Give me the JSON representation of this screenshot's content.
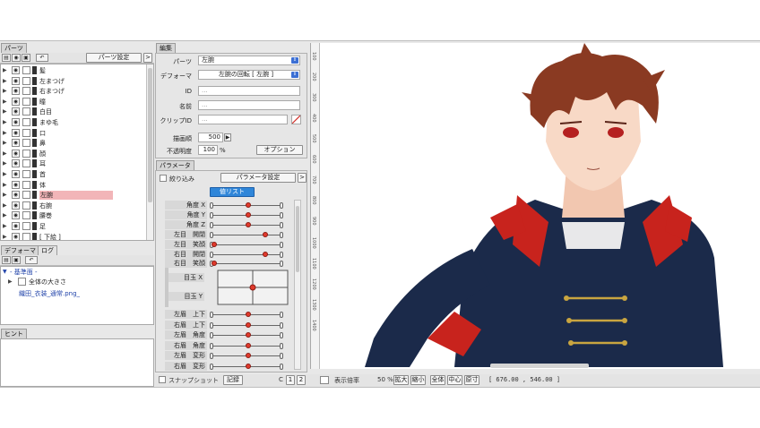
{
  "parts_panel": {
    "tab": "パーツ",
    "settings_button": "パーツ設定",
    "expand_button": ">",
    "items": [
      {
        "label": "髪",
        "selected": false
      },
      {
        "label": "左まつげ",
        "selected": false
      },
      {
        "label": "右まつげ",
        "selected": false
      },
      {
        "label": "瞳",
        "selected": false
      },
      {
        "label": "白目",
        "selected": false
      },
      {
        "label": "まゆ毛",
        "selected": false
      },
      {
        "label": "口",
        "selected": false
      },
      {
        "label": "鼻",
        "selected": false
      },
      {
        "label": "顔",
        "selected": false
      },
      {
        "label": "耳",
        "selected": false
      },
      {
        "label": "首",
        "selected": false
      },
      {
        "label": "体",
        "selected": false
      },
      {
        "label": "左腕",
        "selected": true
      },
      {
        "label": "右腕",
        "selected": false
      },
      {
        "label": "腰巻",
        "selected": false
      },
      {
        "label": "足",
        "selected": false
      },
      {
        "label": "[ 下絵 ]",
        "selected": false
      }
    ]
  },
  "deformer_panel": {
    "tab_deformer": "デフォーマ",
    "tab_log": "ログ",
    "tree_root": "- 基準面 -",
    "tree_child": "全体の大きさ",
    "tree_file": "織田_衣装_通常.png_"
  },
  "hint_panel": {
    "tab": "ヒント"
  },
  "edit_panel": {
    "tab": "編集",
    "parts_label": "パーツ",
    "parts_value": "左腕",
    "deformer_label": "デフォーマ",
    "deformer_value": "左腕の回転 [ 左腕 ]",
    "id_label": "ID",
    "id_value": "...",
    "name_label": "名前",
    "name_value": "...",
    "clip_label": "クリップID",
    "clip_value": "...",
    "draw_order_label": "描画順",
    "draw_order_value": "500",
    "opacity_label": "不透明度",
    "opacity_value": "100",
    "opacity_unit": "%",
    "option_button": "オプション"
  },
  "param_panel": {
    "tab": "パラメータ",
    "filter_label": "絞り込み",
    "settings_button": "パラメータ設定",
    "expand_button": ">",
    "list_button": "値リスト",
    "eye_x_label": "目玉 X",
    "eye_y_label": "目玉 Y",
    "params": [
      {
        "label": "角度 X",
        "value": 0.5
      },
      {
        "label": "角度 Y",
        "value": 0.5
      },
      {
        "label": "角度 Z",
        "value": 0.5
      },
      {
        "label": "左目　開閉",
        "value": 0.75
      },
      {
        "label": "左目　笑顔",
        "value": 0.0
      },
      {
        "label": "右目　開閉",
        "value": 0.75
      },
      {
        "label": "右目　笑顔",
        "value": 0.0
      },
      {
        "label": "左眉　上下",
        "value": 0.5
      },
      {
        "label": "右眉　上下",
        "value": 0.5
      },
      {
        "label": "左眉　角度",
        "value": 0.5
      },
      {
        "label": "右眉　角度",
        "value": 0.5
      },
      {
        "label": "左眉　変形",
        "value": 0.5
      },
      {
        "label": "右眉　変形",
        "value": 0.5
      }
    ]
  },
  "bottom_bar": {
    "snapshot_label": "スナップショット",
    "record_button": "記録",
    "c_label": "C",
    "page1": "1",
    "page2": "2",
    "zoom_label": "表示倍率",
    "zoom_value": "50 %",
    "zoom_in": "拡大",
    "zoom_out": "縮小",
    "fit_all": "全体",
    "center": "中心",
    "actual_size": "原寸",
    "coords": "[   676.00 ,   546.00 ]"
  },
  "ruler": {
    "labels": [
      "100",
      "200",
      "300",
      "400",
      "500",
      "600",
      "700",
      "800",
      "900",
      "1000",
      "1100",
      "1200",
      "1300",
      "1400"
    ]
  },
  "colors": {
    "selected_part": "#f2b5b8",
    "accent_blue": "#3b6fd4",
    "param_knob": "#e03a2c"
  }
}
